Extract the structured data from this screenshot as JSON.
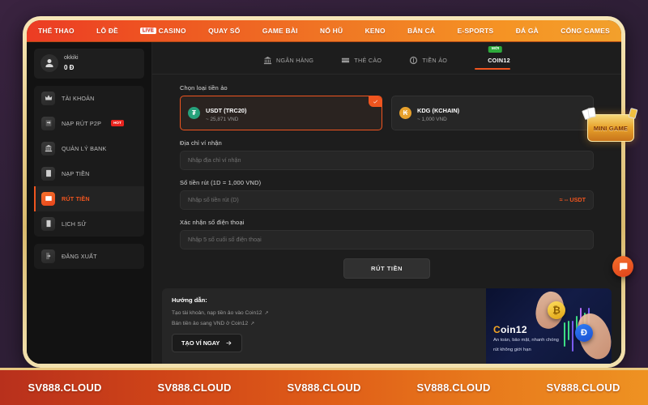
{
  "topnav": {
    "items": [
      {
        "label": "THỂ THAO",
        "badge": null
      },
      {
        "label": "LÔ ĐỀ",
        "badge": null
      },
      {
        "label": "CASINO",
        "badge": "LIVE"
      },
      {
        "label": "QUAY SỐ",
        "badge": null
      },
      {
        "label": "GAME BÀI",
        "badge": null
      },
      {
        "label": "NỔ HŨ",
        "badge": null
      },
      {
        "label": "KENO",
        "badge": null
      },
      {
        "label": "BẮN CÁ",
        "badge": null
      },
      {
        "label": "E-SPORTS",
        "badge": null
      },
      {
        "label": "ĐÁ GÀ",
        "badge": null
      },
      {
        "label": "CỔNG GAMES",
        "badge": null
      }
    ]
  },
  "sidebar": {
    "profile": {
      "username": "okkiki",
      "balance": "0 Đ"
    },
    "group1": [
      {
        "label": "TÀI KHOẢN",
        "icon": "crown-icon",
        "badge": null,
        "active": false
      },
      {
        "label": "NẠP RÚT P2P",
        "icon": "transfer-icon",
        "badge": "HOT",
        "active": false
      },
      {
        "label": "QUẢN LÝ BANK",
        "icon": "bank-icon",
        "badge": null,
        "active": false
      },
      {
        "label": "NẠP TIỀN",
        "icon": "deposit-icon",
        "badge": null,
        "active": false
      },
      {
        "label": "RÚT TIỀN",
        "icon": "withdraw-icon",
        "badge": null,
        "active": true
      },
      {
        "label": "LỊCH SỬ",
        "icon": "history-icon",
        "badge": null,
        "active": false
      }
    ],
    "group2": [
      {
        "label": "ĐĂNG XUẤT",
        "icon": "logout-icon",
        "badge": null,
        "active": false
      }
    ]
  },
  "tabs": [
    {
      "label": "NGÂN HÀNG",
      "icon": "bank-icon",
      "active": false,
      "badge": null
    },
    {
      "label": "THẺ CÀO",
      "icon": "card-icon",
      "active": false,
      "badge": null
    },
    {
      "label": "TIỀN ẢO",
      "icon": "crypto-icon",
      "active": false,
      "badge": null
    },
    {
      "label": "COIN12",
      "icon": "coin12-icon",
      "active": true,
      "badge": "MỚI"
    }
  ],
  "form": {
    "coin_label": "Chọn loại tiền ảo",
    "coins": [
      {
        "symbol": "₮",
        "name": "USDT (TRC20)",
        "rate": "~ 25,871 VND",
        "color": "#26a17b",
        "selected": true
      },
      {
        "symbol": "₭",
        "name": "KDG (KCHAIN)",
        "rate": "~ 1,000 VND",
        "color": "#e8a12c",
        "selected": false
      }
    ],
    "wallet_label": "Địa chỉ ví nhận",
    "wallet_placeholder": "Nhập địa chỉ ví nhận",
    "wallet_value": "",
    "amount_label": "Số tiền rút (1D = 1,000 VND)",
    "amount_placeholder": "Nhập số tiền rút (D)",
    "amount_value": "",
    "amount_suffix": "≈ -- USDT",
    "phone_label": "Xác nhận số điện thoại",
    "phone_placeholder": "Nhập 5 số cuối số điện thoại",
    "phone_value": "",
    "submit_label": "RÚT TIỀN"
  },
  "guide": {
    "title": "Hướng dẫn:",
    "links": [
      "Tạo tài khoản, nạp tiền ảo vào Coin12",
      "Bán tiền ảo sang VND ở Coin12"
    ],
    "cta_label": "TẠO VÍ NGAY",
    "banner": {
      "brand_c": "C",
      "brand_rest": "oin12",
      "line1": "An toàn, bảo mật, nhanh chóng",
      "line2": "rút không giới hạn"
    }
  },
  "floating": {
    "mini_game_label": "MINI GAME",
    "chat_icon": "chat-bubble-icon"
  },
  "brand_strip": {
    "items": [
      "SV888.CLOUD",
      "SV888.CLOUD",
      "SV888.CLOUD",
      "SV888.CLOUD",
      "SV888.CLOUD"
    ]
  },
  "colors": {
    "accent": "#f0551f",
    "nav_start": "#ec3c24",
    "nav_end": "#f2a02c",
    "new_badge": "#2eab3c",
    "hot_badge": "#e8241f"
  }
}
